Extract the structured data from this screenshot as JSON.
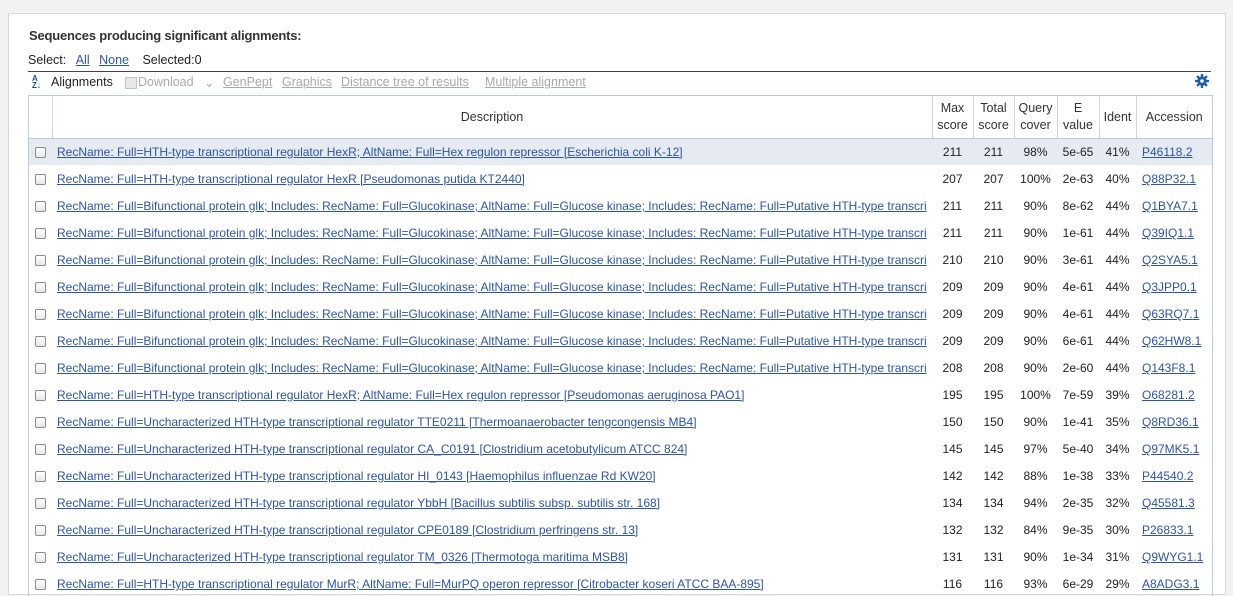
{
  "title": "Sequences producing significant alignments:",
  "select": {
    "label": "Select:",
    "all": "All",
    "none": "None",
    "selected": "Selected:0"
  },
  "toolbar": {
    "alignments": "Alignments",
    "download": "Download",
    "download_chevron": "⌄",
    "genpept": "GenPept",
    "graphics": "Graphics",
    "distance_tree": "Distance tree of results",
    "multiple_alignment": "Multiple alignment",
    "settings_icon": "gear-icon"
  },
  "columns": {
    "description": "Description",
    "max_score_1": "Max",
    "max_score_2": "score",
    "total_score_1": "Total",
    "total_score_2": "score",
    "query_cover_1": "Query",
    "query_cover_2": "cover",
    "evalue_1": "E",
    "evalue_2": "value",
    "ident": "Ident",
    "accession": "Accession"
  },
  "highlight_color": "#e5ebf0",
  "rows": [
    {
      "desc": "RecName: Full=HTH-type transcriptional regulator HexR; AltName: Full=Hex regulon repressor [Escherichia coli K-12]",
      "max": "211",
      "total": "211",
      "cover": "98%",
      "evalue": "5e-65",
      "ident": "41%",
      "acc": "P46118.2"
    },
    {
      "desc": "RecName: Full=HTH-type transcriptional regulator HexR [Pseudomonas putida KT2440]",
      "max": "207",
      "total": "207",
      "cover": "100%",
      "evalue": "2e-63",
      "ident": "40%",
      "acc": "Q88P32.1"
    },
    {
      "desc": "RecName: Full=Bifunctional protein glk; Includes: RecName: Full=Glucokinase; AltName: Full=Glucose kinase; Includes: RecName: Full=Putative HTH-type transcri",
      "max": "211",
      "total": "211",
      "cover": "90%",
      "evalue": "8e-62",
      "ident": "44%",
      "acc": "Q1BYA7.1"
    },
    {
      "desc": "RecName: Full=Bifunctional protein glk; Includes: RecName: Full=Glucokinase; AltName: Full=Glucose kinase; Includes: RecName: Full=Putative HTH-type transcri",
      "max": "211",
      "total": "211",
      "cover": "90%",
      "evalue": "1e-61",
      "ident": "44%",
      "acc": "Q39IQ1.1"
    },
    {
      "desc": "RecName: Full=Bifunctional protein glk; Includes: RecName: Full=Glucokinase; AltName: Full=Glucose kinase; Includes: RecName: Full=Putative HTH-type transcri",
      "max": "210",
      "total": "210",
      "cover": "90%",
      "evalue": "3e-61",
      "ident": "44%",
      "acc": "Q2SYA5.1"
    },
    {
      "desc": "RecName: Full=Bifunctional protein glk; Includes: RecName: Full=Glucokinase; AltName: Full=Glucose kinase; Includes: RecName: Full=Putative HTH-type transcri",
      "max": "209",
      "total": "209",
      "cover": "90%",
      "evalue": "4e-61",
      "ident": "44%",
      "acc": "Q3JPP0.1"
    },
    {
      "desc": "RecName: Full=Bifunctional protein glk; Includes: RecName: Full=Glucokinase; AltName: Full=Glucose kinase; Includes: RecName: Full=Putative HTH-type transcri",
      "max": "209",
      "total": "209",
      "cover": "90%",
      "evalue": "4e-61",
      "ident": "44%",
      "acc": "Q63RQ7.1"
    },
    {
      "desc": "RecName: Full=Bifunctional protein glk; Includes: RecName: Full=Glucokinase; AltName: Full=Glucose kinase; Includes: RecName: Full=Putative HTH-type transcri",
      "max": "209",
      "total": "209",
      "cover": "90%",
      "evalue": "6e-61",
      "ident": "44%",
      "acc": "Q62HW8.1"
    },
    {
      "desc": "RecName: Full=Bifunctional protein glk; Includes: RecName: Full=Glucokinase; AltName: Full=Glucose kinase; Includes: RecName: Full=Putative HTH-type transcri",
      "max": "208",
      "total": "208",
      "cover": "90%",
      "evalue": "2e-60",
      "ident": "44%",
      "acc": "Q143F8.1"
    },
    {
      "desc": "RecName: Full=HTH-type transcriptional regulator HexR; AltName: Full=Hex regulon repressor [Pseudomonas aeruginosa PAO1]",
      "max": "195",
      "total": "195",
      "cover": "100%",
      "evalue": "7e-59",
      "ident": "39%",
      "acc": "O68281.2"
    },
    {
      "desc": "RecName: Full=Uncharacterized HTH-type transcriptional regulator TTE0211 [Thermoanaerobacter tengcongensis MB4]",
      "max": "150",
      "total": "150",
      "cover": "90%",
      "evalue": "1e-41",
      "ident": "35%",
      "acc": "Q8RD36.1"
    },
    {
      "desc": "RecName: Full=Uncharacterized HTH-type transcriptional regulator CA_C0191 [Clostridium acetobutylicum ATCC 824]",
      "max": "145",
      "total": "145",
      "cover": "97%",
      "evalue": "5e-40",
      "ident": "34%",
      "acc": "Q97MK5.1"
    },
    {
      "desc": "RecName: Full=Uncharacterized HTH-type transcriptional regulator HI_0143 [Haemophilus influenzae Rd KW20]",
      "max": "142",
      "total": "142",
      "cover": "88%",
      "evalue": "1e-38",
      "ident": "33%",
      "acc": "P44540.2"
    },
    {
      "desc": "RecName: Full=Uncharacterized HTH-type transcriptional regulator YbbH [Bacillus subtilis subsp. subtilis str. 168]",
      "max": "134",
      "total": "134",
      "cover": "94%",
      "evalue": "2e-35",
      "ident": "32%",
      "acc": "Q45581.3"
    },
    {
      "desc": "RecName: Full=Uncharacterized HTH-type transcriptional regulator CPE0189 [Clostridium perfringens str. 13]",
      "max": "132",
      "total": "132",
      "cover": "84%",
      "evalue": "9e-35",
      "ident": "30%",
      "acc": "P26833.1"
    },
    {
      "desc": "RecName: Full=Uncharacterized HTH-type transcriptional regulator TM_0326 [Thermotoga maritima MSB8]",
      "max": "131",
      "total": "131",
      "cover": "90%",
      "evalue": "1e-34",
      "ident": "31%",
      "acc": "Q9WYG1.1"
    },
    {
      "desc": "RecName: Full=HTH-type transcriptional regulator MurR; AltName: Full=MurPQ operon repressor [Citrobacter koseri ATCC BAA-895]",
      "max": "116",
      "total": "116",
      "cover": "93%",
      "evalue": "6e-29",
      "ident": "29%",
      "acc": "A8ADG3.1"
    }
  ]
}
